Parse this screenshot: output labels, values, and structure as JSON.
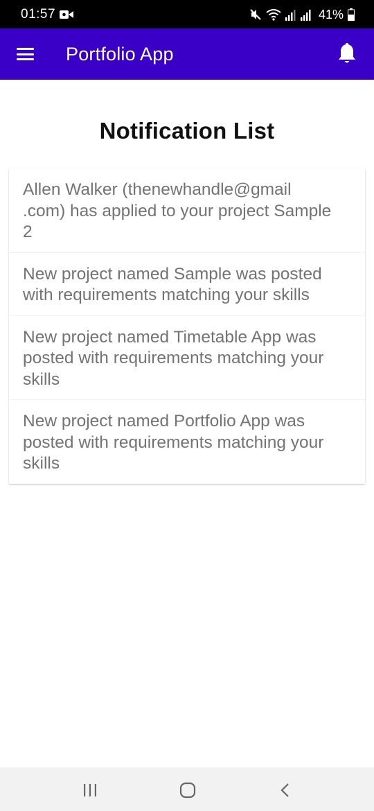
{
  "status_bar": {
    "time": "01:57",
    "battery": "41%"
  },
  "app_bar": {
    "title": "Portfolio App",
    "menu_icon": "hamburger-menu-icon",
    "notification_icon": "bell-icon",
    "background_color": "#3b00c8"
  },
  "main": {
    "title": "Notification List",
    "notifications": [
      {
        "lines": [
          "Allen Walker (thenewhandle@gmail",
          ".com) has applied to your project Sample",
          "2"
        ]
      },
      {
        "lines": [
          "New project named Sample was posted",
          "with requirements matching your skills"
        ]
      },
      {
        "lines": [
          "New project named Timetable App was",
          "posted with requirements matching your",
          "skills"
        ]
      },
      {
        "lines": [
          "New project named Portfolio App was",
          "posted with requirements matching your",
          "skills"
        ]
      }
    ]
  },
  "nav_bar": {
    "recents_icon": "recents-icon",
    "home_icon": "home-icon",
    "back_icon": "back-icon"
  }
}
